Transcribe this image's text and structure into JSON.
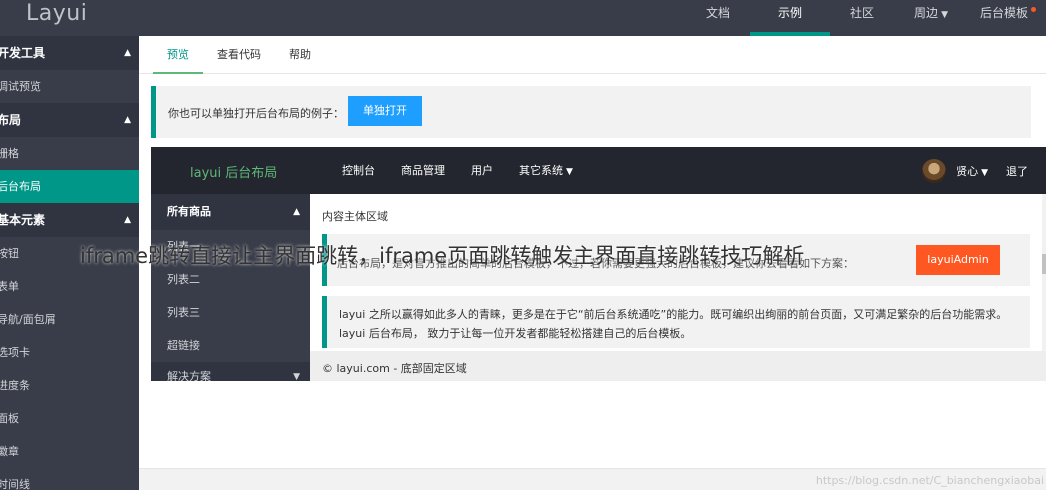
{
  "header": {
    "logo": "Layui",
    "nav": [
      {
        "label": "文档"
      },
      {
        "label": "示例"
      },
      {
        "label": "社区"
      },
      {
        "label": "周边"
      },
      {
        "label": "后台模板"
      }
    ]
  },
  "sidebar": {
    "groups": [
      {
        "label": "开发工具",
        "items": [
          "调试预览"
        ]
      },
      {
        "label": "布局",
        "items": [
          "栅格",
          "后台布局"
        ]
      },
      {
        "label": "基本元素",
        "items": [
          "按钮",
          "表单",
          "导航/面包屑",
          "选项卡",
          "进度条",
          "面板",
          "徽章",
          "时间线"
        ]
      }
    ]
  },
  "tabs": [
    "预览",
    "查看代码",
    "帮助"
  ],
  "quote": {
    "text": "你也可以单独打开后台布局的例子：",
    "button": "单独打开"
  },
  "demo": {
    "logo": "layui 后台布局",
    "nav": [
      "控制台",
      "商品管理",
      "用户",
      "其它系统"
    ],
    "user": "贤心",
    "logout": "退了",
    "side": {
      "group": "所有商品",
      "items": [
        "列表一",
        "列表二",
        "列表三",
        "超链接"
      ],
      "group2": "解决方案"
    },
    "body": {
      "title": "内容主体区域",
      "quote1": "后台布局，是对官方推出的简单的后台模板，不过，若你需要更强大的后台模板，建议你去看看如下方案：",
      "button": "layuiAdmin",
      "quote2_line1": "layui 之所以赢得如此多人的青睐，更多是在于它“前后台系统通吃”的能力。既可编织出绚丽的前台页面，又可满足繁杂的后台功能需求。",
      "quote2_line2": "layui 后台布局， 致力于让每一位开发者都能轻松搭建自己的后台模板。"
    },
    "footer": "© layui.com - 底部固定区域"
  },
  "overlay_title": "iframe跳转直接让主界面跳转，iframe页面跳转触发主界面直接跳转技巧解析",
  "watermark": "https://blog.csdn.net/C_bianchengxiaobai"
}
